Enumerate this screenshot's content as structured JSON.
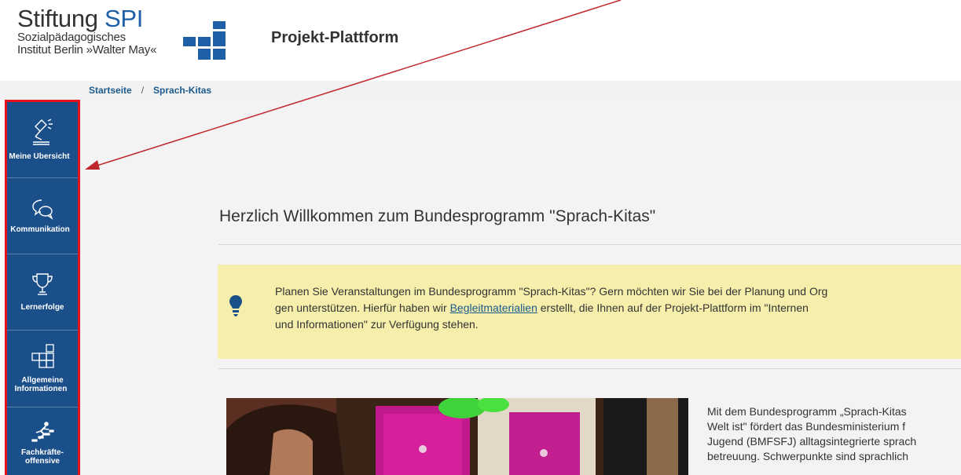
{
  "header": {
    "logo_main_a": "Stiftung ",
    "logo_main_b": "SPI",
    "logo_sub_1": "Sozialpädagogisches",
    "logo_sub_2": "Institut Berlin »Walter May«",
    "platform_title": "Projekt-Plattform"
  },
  "breadcrumb": {
    "home": "Startseite",
    "separator": "/",
    "current": "Sprach-Kitas"
  },
  "sidebar": {
    "items": [
      {
        "label": "Meine Übersicht",
        "icon": "desk-lamp-icon"
      },
      {
        "label": "Kommunikation",
        "icon": "chat-bubbles-icon"
      },
      {
        "label": "Lernerfolge",
        "icon": "trophy-icon"
      },
      {
        "label_1": "Allgemeine",
        "label_2": "Informationen",
        "icon": "grid-blocks-icon"
      },
      {
        "label_1": "Fachkräfte-",
        "label_2": "offensive",
        "icon": "climber-icon"
      }
    ]
  },
  "main": {
    "heading": "Herzlich Willkommen zum Bundesprogramm \"Sprach-Kitas\"",
    "info": {
      "line1": "Planen Sie Veranstaltungen im Bundesprogramm \"Sprach-Kitas\"? Gern möchten wir Sie bei der Planung und Org",
      "line2_pre": "gen unterstützen. Hierfür haben wir ",
      "line2_link": "Begleitmaterialien",
      "line2_post": " erstellt, die Ihnen auf der Projekt-Plattform im \"Internen",
      "line3": "und Informationen\" zur Verfügung stehen.",
      "icon": "lightbulb-icon"
    },
    "body_lines": [
      "Mit dem Bundesprogramm „Sprach-Kitas",
      "Welt ist\" fördert das Bundesministerium f",
      "Jugend (BMFSFJ) alltagsintegrierte sprach",
      "betreuung. Schwerpunkte sind sprachlich"
    ]
  },
  "colors": {
    "sidebar_bg": "#1b4f8a",
    "highlight_border": "#e5121a",
    "info_box_bg": "#f6eeab",
    "link": "#1b5a8e",
    "brand_blue": "#1f5fa8"
  }
}
